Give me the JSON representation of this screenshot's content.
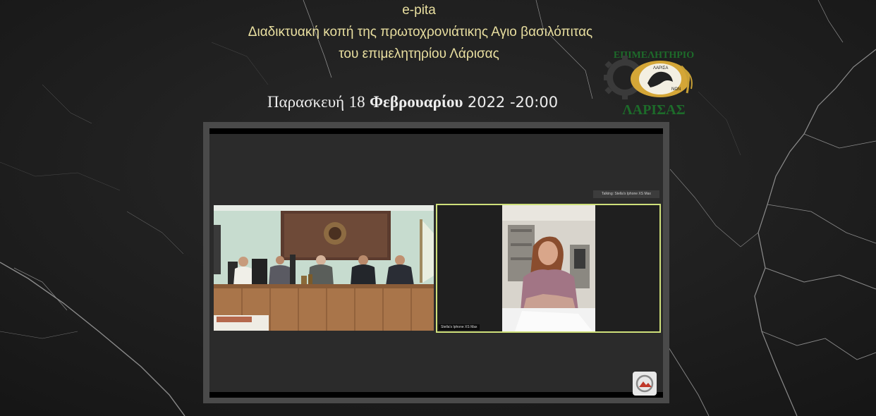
{
  "header": {
    "line1": "e-pita",
    "line2": "Διαδικτυακή κοπή της πρωτοχρονιάτικης Αγιο βασιλόπιτας",
    "line3": "του επιμελητηρίου Λάρισας"
  },
  "date": {
    "weekday": "Παρασκευή",
    "day": "18",
    "month": "Φεβρουαρίου",
    "year_time": "2022 -20:00"
  },
  "logo": {
    "top_text": "ΕΠΙΜΕΛΗΤΗΡΙΟ",
    "bottom_text": "ΛΑΡΙΣΑΣ",
    "badge_left": "ΛΑΡΙΣΑ",
    "badge_right": "ΝΩΝ"
  },
  "meeting": {
    "talking_indicator": "Talking: Stella's Iphone XS Max",
    "right_tile_name": "Stella's Iphone XS Max",
    "pip_icon": "picture-in-picture-icon"
  },
  "colors": {
    "title_text": "#e9dfa0",
    "date_text": "#ededed",
    "active_speaker_border": "#cfe07a",
    "logo_green": "#1d6b2a"
  }
}
